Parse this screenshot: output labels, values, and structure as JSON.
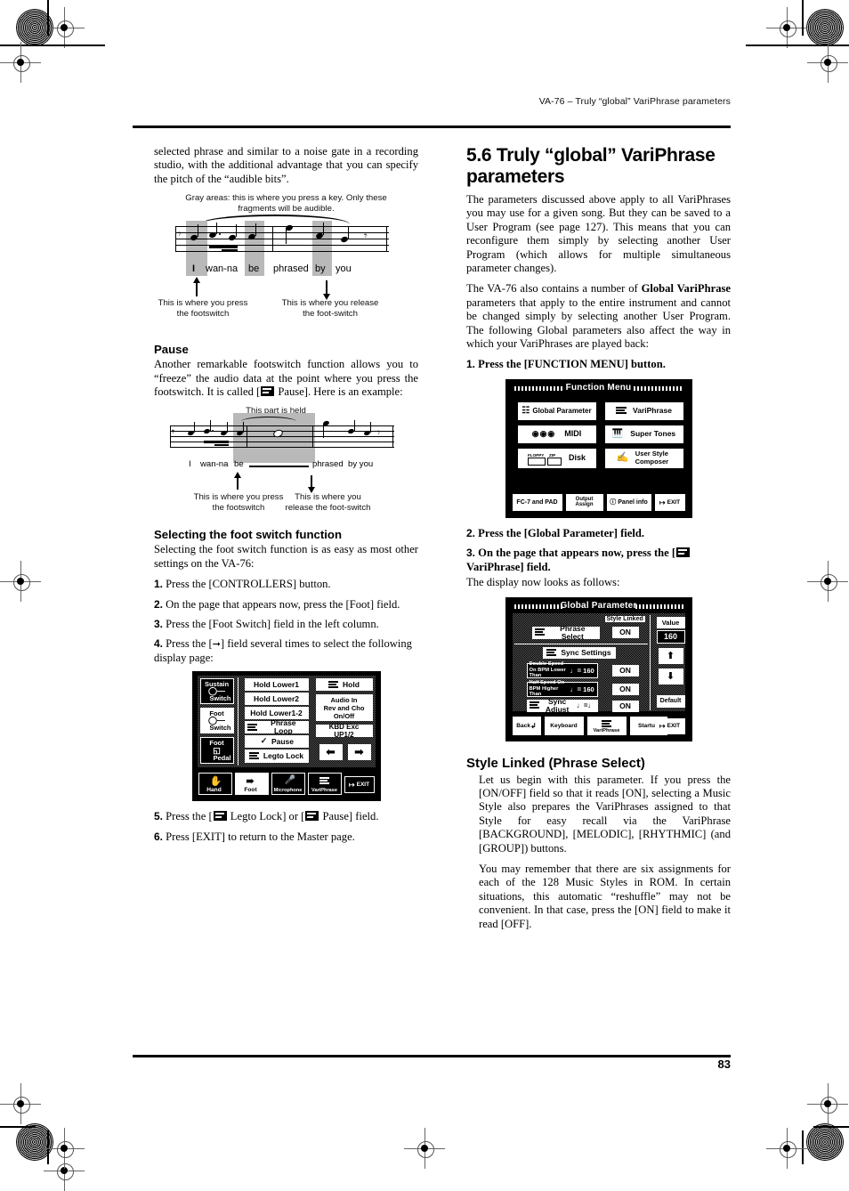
{
  "page": {
    "header": "VA-76 – Truly “global” VariPhrase parameters",
    "number": "83"
  },
  "left_column": {
    "intro": "selected phrase and similar to a noise gate in a recording studio, with the additional advantage that you can specify the pitch of the “audible bits”.",
    "figure1": {
      "caption": "Gray areas: this is where you press a key. Only these fragments will be audible.",
      "lyrics": [
        "I",
        "wan-na",
        "be",
        "phrased",
        "by",
        "you"
      ],
      "note_left": "This is where you press the footswitch",
      "note_right": "This is where you release the foot-switch"
    },
    "pause": {
      "heading": "Pause",
      "body_1": "Another remarkable footswitch function allows you to “freeze” the audio data at the point where you press the footswitch. It is called [",
      "body_2": " Pause]. Here is an example:",
      "figure2": {
        "caption": "This part is held",
        "lyrics": [
          "I",
          "wan-na",
          "be",
          "phrased",
          "by you"
        ],
        "note_left": "This is where you press the footswitch",
        "note_right": "This is where you release the foot-switch"
      }
    },
    "selecting": {
      "heading": "Selecting the foot switch function",
      "intro": "Selecting the foot switch function is as easy as most other settings on the VA-76:",
      "steps": [
        {
          "num": "1.",
          "text": "Press the [CONTROLLERS] button."
        },
        {
          "num": "2.",
          "text": "On the page that appears now, press the [Foot] field."
        },
        {
          "num": "3.",
          "text": "Press the [Foot Switch] field in the left column."
        },
        {
          "num": "4.",
          "pre": "Press the [",
          "icon": "arrow-right-icon",
          "post": "] field several times to select the following display page:"
        }
      ],
      "steps_after": [
        {
          "num": "5.",
          "pre": "Press the [",
          "mid": " Legto Lock] or [",
          "post": " Pause] field."
        },
        {
          "num": "6.",
          "text": "Press [EXIT] to return to the Master page."
        }
      ]
    },
    "lcd_foot": {
      "left_buttons": [
        {
          "line1": "Sustain",
          "line2": "Switch",
          "icon": "pedal-icon",
          "selected": false
        },
        {
          "line1": "Foot",
          "line2": "Switch",
          "icon": "pedal-icon",
          "selected": true
        },
        {
          "line1": "Foot",
          "line2": "Pedal",
          "icon": "expression-pedal-icon",
          "selected": false
        }
      ],
      "mid_buttons": [
        "Hold Lower1",
        "Hold Lower2",
        "Hold Lower1-2",
        "Phrase Loop",
        "Pause",
        "Legto Lock"
      ],
      "right_buttons": [
        "Hold",
        "Audio In\nRev and Cho\nOn/Off",
        "KBD Exc UP1/2"
      ],
      "nav": [
        "left-arrow-icon",
        "right-arrow-icon"
      ],
      "tabs": [
        "Hand",
        "Foot",
        "Microphone",
        "VariPhrase",
        "EXIT"
      ],
      "selected_tab": "Foot"
    }
  },
  "right_column": {
    "section_title": "5.6 Truly “global” VariPhrase parameters",
    "para_1": "The parameters discussed above apply to all VariPhrases you may use for a given song. But they can be saved to a User Program (see page 127). This means that you can reconfigure them simply by selecting another User Program (which allows for multiple simultaneous parameter changes).",
    "para_2_a": "The VA-76 also contains a number of ",
    "para_2_b": "Global VariPhrase",
    "para_2_c": " parameters that apply to the entire instrument and cannot be changed simply by selecting another User Program. The following Global parameters also affect the way in which your VariPhrases are played back:",
    "step_1": {
      "num": "1.",
      "text": "Press the [FUNCTION MENU] button."
    },
    "step_2": {
      "num": "2.",
      "text": "Press the [Global Parameter] field."
    },
    "step_3": {
      "num": "3.",
      "pre": "On the page that appears now, press the [",
      "post": " VariPhrase] field."
    },
    "step_3_note": "The display now looks as follows:",
    "lcd_function_menu": {
      "title": "Function Menu",
      "items": [
        {
          "label": "Global Parameter",
          "icon": "global-parameter-icon"
        },
        {
          "label": "VariPhrase",
          "icon": "variphrase-icon"
        },
        {
          "label": "MIDI",
          "icon": "midi-knobs-icon"
        },
        {
          "label": "Super Tones",
          "icon": "piano-icon"
        },
        {
          "label": "Disk",
          "icon": "floppy-zip-icon",
          "sub": [
            "FLOPPY",
            "ZIP"
          ]
        },
        {
          "label": "User Style Composer",
          "icon": "composer-icon"
        }
      ],
      "tabs": [
        "FC-7 and PAD",
        "Output Assign",
        "Panel info",
        "EXIT"
      ]
    },
    "lcd_global_parameter": {
      "title": "Global Parameter",
      "column_header": "Style Linked",
      "value_label": "Value",
      "value": "160",
      "default_label": "Default",
      "rows": [
        {
          "label": "Phrase Select",
          "icon": "variphrase-icon",
          "state": "ON"
        },
        {
          "label": "Sync Settings",
          "icon": "variphrase-icon",
          "state": ""
        },
        {
          "label": "Double Speed On BPM Lower Than",
          "value": "160",
          "state": "ON"
        },
        {
          "label": "Half Speed On BPM Higher Than",
          "value": "160",
          "state": "ON"
        },
        {
          "label": "Sync Adjust",
          "icon": "variphrase-icon",
          "state": "ON"
        }
      ],
      "tabs": [
        "Back",
        "Keyboard",
        "VariPhrase",
        "Startup",
        "EXIT"
      ],
      "selected_tab": "VariPhrase"
    },
    "style_linked": {
      "heading": "Style Linked (Phrase Select)",
      "para_1": "Let us begin with this parameter. If you press the [ON/OFF] field so that it reads [ON], selecting a Music Style also prepares the VariPhrases assigned to that Style for easy recall via the VariPhrase [BACKGROUND], [MELODIC], [RHYTHMIC] (and [GROUP]) buttons.",
      "para_2": "You may remember that there are six assignments for each of the 128 Music Styles in ROM. In certain situations, this automatic “reshuffle” may not be convenient. In that case, press the [ON] field to make it read [OFF]."
    }
  }
}
